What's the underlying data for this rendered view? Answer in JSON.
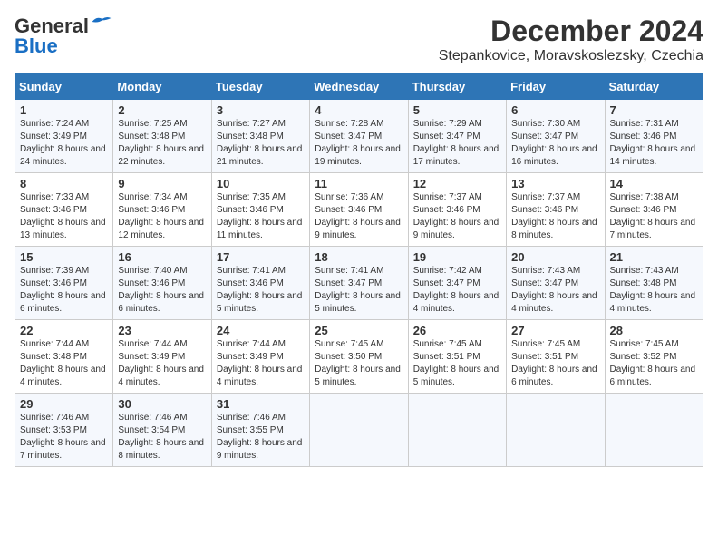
{
  "header": {
    "logo_line1": "General",
    "logo_line2": "Blue",
    "title": "December 2024",
    "subtitle": "Stepankovice, Moravskoslezsky, Czechia"
  },
  "days_of_week": [
    "Sunday",
    "Monday",
    "Tuesday",
    "Wednesday",
    "Thursday",
    "Friday",
    "Saturday"
  ],
  "weeks": [
    [
      {
        "day": "1",
        "sunrise": "7:24 AM",
        "sunset": "3:49 PM",
        "daylight": "8 hours and 24 minutes."
      },
      {
        "day": "2",
        "sunrise": "7:25 AM",
        "sunset": "3:48 PM",
        "daylight": "8 hours and 22 minutes."
      },
      {
        "day": "3",
        "sunrise": "7:27 AM",
        "sunset": "3:48 PM",
        "daylight": "8 hours and 21 minutes."
      },
      {
        "day": "4",
        "sunrise": "7:28 AM",
        "sunset": "3:47 PM",
        "daylight": "8 hours and 19 minutes."
      },
      {
        "day": "5",
        "sunrise": "7:29 AM",
        "sunset": "3:47 PM",
        "daylight": "8 hours and 17 minutes."
      },
      {
        "day": "6",
        "sunrise": "7:30 AM",
        "sunset": "3:47 PM",
        "daylight": "8 hours and 16 minutes."
      },
      {
        "day": "7",
        "sunrise": "7:31 AM",
        "sunset": "3:46 PM",
        "daylight": "8 hours and 14 minutes."
      }
    ],
    [
      {
        "day": "8",
        "sunrise": "7:33 AM",
        "sunset": "3:46 PM",
        "daylight": "8 hours and 13 minutes."
      },
      {
        "day": "9",
        "sunrise": "7:34 AM",
        "sunset": "3:46 PM",
        "daylight": "8 hours and 12 minutes."
      },
      {
        "day": "10",
        "sunrise": "7:35 AM",
        "sunset": "3:46 PM",
        "daylight": "8 hours and 11 minutes."
      },
      {
        "day": "11",
        "sunrise": "7:36 AM",
        "sunset": "3:46 PM",
        "daylight": "8 hours and 9 minutes."
      },
      {
        "day": "12",
        "sunrise": "7:37 AM",
        "sunset": "3:46 PM",
        "daylight": "8 hours and 9 minutes."
      },
      {
        "day": "13",
        "sunrise": "7:37 AM",
        "sunset": "3:46 PM",
        "daylight": "8 hours and 8 minutes."
      },
      {
        "day": "14",
        "sunrise": "7:38 AM",
        "sunset": "3:46 PM",
        "daylight": "8 hours and 7 minutes."
      }
    ],
    [
      {
        "day": "15",
        "sunrise": "7:39 AM",
        "sunset": "3:46 PM",
        "daylight": "8 hours and 6 minutes."
      },
      {
        "day": "16",
        "sunrise": "7:40 AM",
        "sunset": "3:46 PM",
        "daylight": "8 hours and 6 minutes."
      },
      {
        "day": "17",
        "sunrise": "7:41 AM",
        "sunset": "3:46 PM",
        "daylight": "8 hours and 5 minutes."
      },
      {
        "day": "18",
        "sunrise": "7:41 AM",
        "sunset": "3:47 PM",
        "daylight": "8 hours and 5 minutes."
      },
      {
        "day": "19",
        "sunrise": "7:42 AM",
        "sunset": "3:47 PM",
        "daylight": "8 hours and 4 minutes."
      },
      {
        "day": "20",
        "sunrise": "7:43 AM",
        "sunset": "3:47 PM",
        "daylight": "8 hours and 4 minutes."
      },
      {
        "day": "21",
        "sunrise": "7:43 AM",
        "sunset": "3:48 PM",
        "daylight": "8 hours and 4 minutes."
      }
    ],
    [
      {
        "day": "22",
        "sunrise": "7:44 AM",
        "sunset": "3:48 PM",
        "daylight": "8 hours and 4 minutes."
      },
      {
        "day": "23",
        "sunrise": "7:44 AM",
        "sunset": "3:49 PM",
        "daylight": "8 hours and 4 minutes."
      },
      {
        "day": "24",
        "sunrise": "7:44 AM",
        "sunset": "3:49 PM",
        "daylight": "8 hours and 4 minutes."
      },
      {
        "day": "25",
        "sunrise": "7:45 AM",
        "sunset": "3:50 PM",
        "daylight": "8 hours and 5 minutes."
      },
      {
        "day": "26",
        "sunrise": "7:45 AM",
        "sunset": "3:51 PM",
        "daylight": "8 hours and 5 minutes."
      },
      {
        "day": "27",
        "sunrise": "7:45 AM",
        "sunset": "3:51 PM",
        "daylight": "8 hours and 6 minutes."
      },
      {
        "day": "28",
        "sunrise": "7:45 AM",
        "sunset": "3:52 PM",
        "daylight": "8 hours and 6 minutes."
      }
    ],
    [
      {
        "day": "29",
        "sunrise": "7:46 AM",
        "sunset": "3:53 PM",
        "daylight": "8 hours and 7 minutes."
      },
      {
        "day": "30",
        "sunrise": "7:46 AM",
        "sunset": "3:54 PM",
        "daylight": "8 hours and 8 minutes."
      },
      {
        "day": "31",
        "sunrise": "7:46 AM",
        "sunset": "3:55 PM",
        "daylight": "8 hours and 9 minutes."
      },
      null,
      null,
      null,
      null
    ]
  ],
  "labels": {
    "sunrise": "Sunrise:",
    "sunset": "Sunset:",
    "daylight": "Daylight:"
  }
}
